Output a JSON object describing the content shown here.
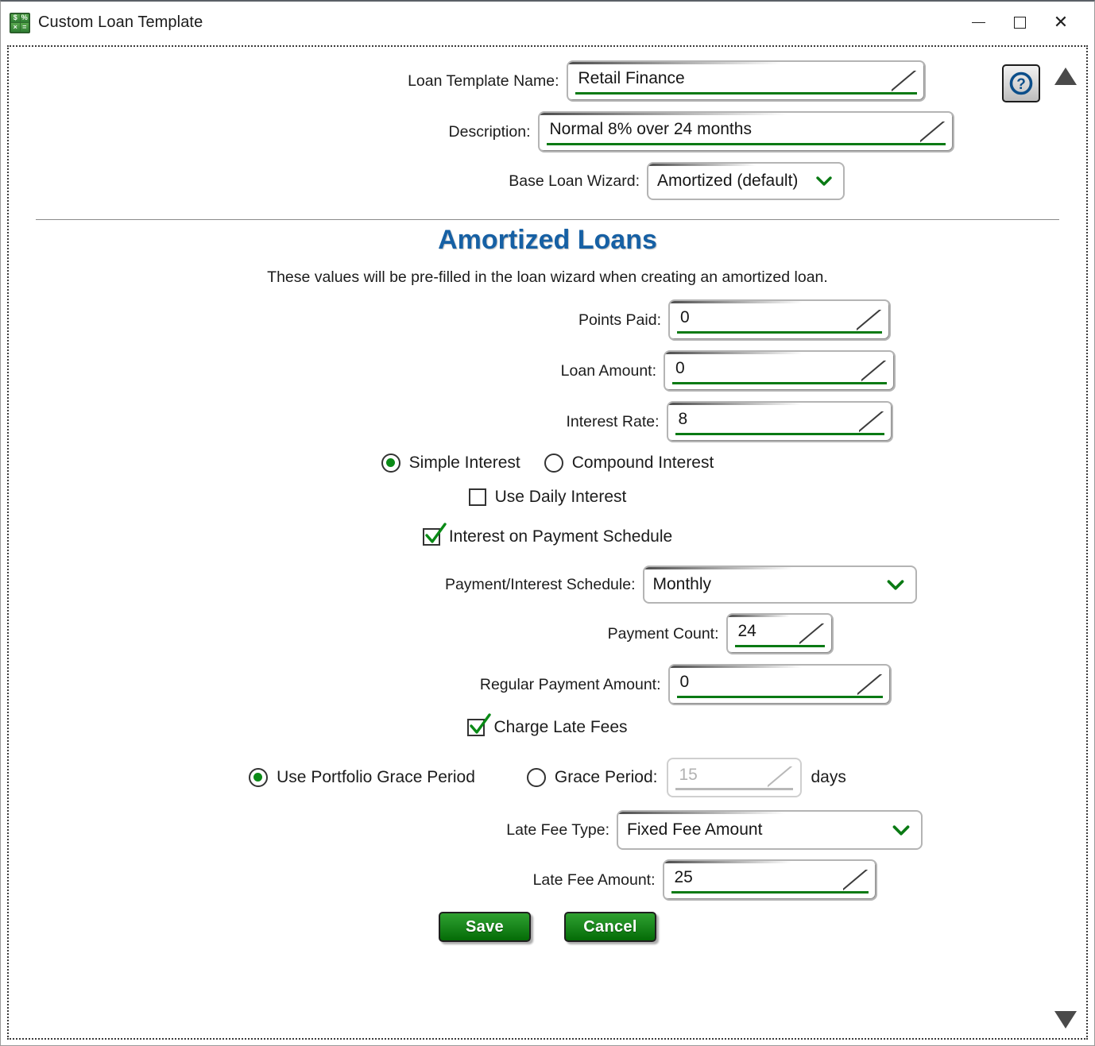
{
  "window": {
    "title": "Custom Loan Template",
    "app_icon": "calculator-icon",
    "icon_glyphs": [
      "$",
      "%",
      "×",
      "="
    ],
    "minimize_label": "─",
    "maximize_label": "□",
    "close_label": "✕"
  },
  "toolbar": {
    "help_label": "?",
    "scroll_up_label": "▲",
    "scroll_down_label": "▼"
  },
  "header_form": {
    "template_name": {
      "label": "Loan Template Name:",
      "value": "Retail Finance"
    },
    "description": {
      "label": "Description:",
      "value": "Normal 8% over 24 months"
    },
    "base_wizard": {
      "label": "Base Loan Wizard:",
      "value": "Amortized (default)",
      "options": [
        "Amortized (default)"
      ]
    }
  },
  "section": {
    "title": "Amortized Loans",
    "subtitle": "These values will be pre-filled in the loan wizard when creating an amortized loan."
  },
  "fields": {
    "points_paid": {
      "label": "Points Paid:",
      "value": "0"
    },
    "loan_amount": {
      "label": "Loan Amount:",
      "value": "0"
    },
    "interest_rate": {
      "label": "Interest Rate:",
      "value": "8"
    },
    "payment_schedule": {
      "label": "Payment/Interest Schedule:",
      "value": "Monthly",
      "options": [
        "Monthly"
      ]
    },
    "payment_count": {
      "label": "Payment Count:",
      "value": "24"
    },
    "regular_payment_amount": {
      "label": "Regular Payment Amount:",
      "value": "0"
    },
    "grace_period": {
      "label": "Grace Period:",
      "value": "15",
      "unit": "days",
      "enabled": false
    },
    "late_fee_type": {
      "label": "Late Fee Type:",
      "value": "Fixed Fee Amount",
      "options": [
        "Fixed Fee Amount"
      ]
    },
    "late_fee_amount": {
      "label": "Late Fee Amount:",
      "value": "25"
    }
  },
  "interest_type": {
    "simple": {
      "label": "Simple Interest",
      "selected": true
    },
    "compound": {
      "label": "Compound Interest",
      "selected": false
    }
  },
  "checkboxes": {
    "use_daily_interest": {
      "label": "Use Daily Interest",
      "checked": false
    },
    "interest_on_payment_schedule": {
      "label": "Interest on Payment Schedule",
      "checked": true
    },
    "charge_late_fees": {
      "label": "Charge Late Fees",
      "checked": true
    }
  },
  "grace_mode": {
    "portfolio": {
      "label": "Use Portfolio Grace Period",
      "selected": true
    },
    "custom": {
      "label": "Grace Period:",
      "selected": false
    }
  },
  "buttons": {
    "save": "Save",
    "cancel": "Cancel"
  },
  "colors": {
    "accent_green": "#0a7a14",
    "heading_blue": "#1660a4",
    "button_green": "#1d8b20",
    "disabled_gray": "#b2b2b2"
  }
}
